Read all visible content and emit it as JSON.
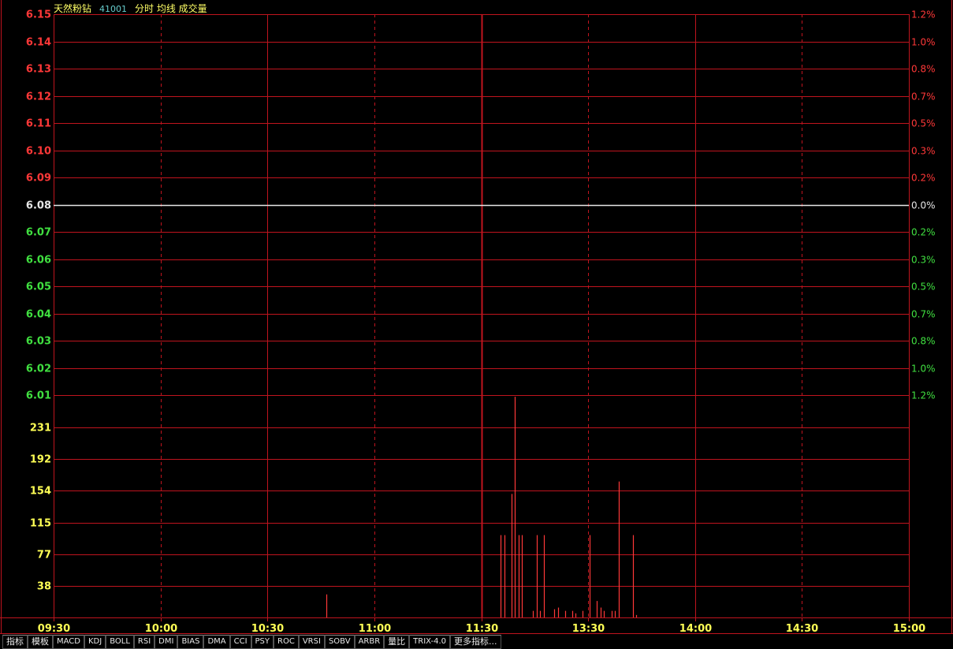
{
  "header": {
    "name": "天然粉钻",
    "code": "41001",
    "tags": "分时 均线 成交量"
  },
  "colors": {
    "grid": "#c0141e",
    "up": "#ff3838",
    "down": "#40e040",
    "base": "#e6e6e6",
    "vol_label": "#ffff55",
    "time_label": "#ffff55",
    "volume_bar": "#ff3838"
  },
  "tabs": [
    "指标",
    "模板",
    "MACD",
    "KDJ",
    "BOLL",
    "RSI",
    "DMI",
    "BIAS",
    "DMA",
    "CCI",
    "PSY",
    "ROC",
    "VRSI",
    "SOBV",
    "ARBR",
    "量比",
    "TRIX-4.0",
    "更多指标..."
  ],
  "chart_data": {
    "type": "bar",
    "price_axis": {
      "ticks": [
        "6.15",
        "6.14",
        "6.13",
        "6.12",
        "6.11",
        "6.10",
        "6.09",
        "6.08",
        "6.07",
        "6.06",
        "6.05",
        "6.04",
        "6.03",
        "6.02",
        "6.01"
      ],
      "pct": [
        "1.2%",
        "1.0%",
        "0.8%",
        "0.7%",
        "0.5%",
        "0.3%",
        "0.2%",
        "0.0%",
        "0.2%",
        "0.3%",
        "0.5%",
        "0.7%",
        "0.8%",
        "1.0%",
        "1.2%"
      ],
      "baseline": 6.08
    },
    "price_line": {
      "value": 6.08
    },
    "volume_axis": {
      "ticks": [
        "231",
        "192",
        "154",
        "115",
        "77",
        "38"
      ],
      "ylim": [
        0,
        270
      ]
    },
    "time_axis": {
      "ticks": [
        "09:30",
        "10:00",
        "10:30",
        "11:00",
        "11:30",
        "13:30",
        "14:00",
        "14:30",
        "15:00"
      ],
      "session_minutes": 240
    },
    "volume_series": {
      "minute": [
        76.5,
        125.5,
        126.5,
        128.5,
        129.5,
        130.5,
        131.5,
        134.5,
        135.5,
        136.5,
        137.5,
        140.5,
        141.5,
        143.5,
        145.5,
        146.5,
        148.5,
        150.5,
        152.5,
        153.5,
        154.5,
        156.5,
        157.5,
        158.5,
        162.5,
        163.5
      ],
      "value": [
        28,
        100,
        100,
        150,
        268,
        100,
        100,
        8,
        100,
        8,
        100,
        10,
        12,
        8,
        8,
        5,
        8,
        100,
        20,
        12,
        8,
        8,
        8,
        165,
        100,
        3
      ]
    }
  }
}
